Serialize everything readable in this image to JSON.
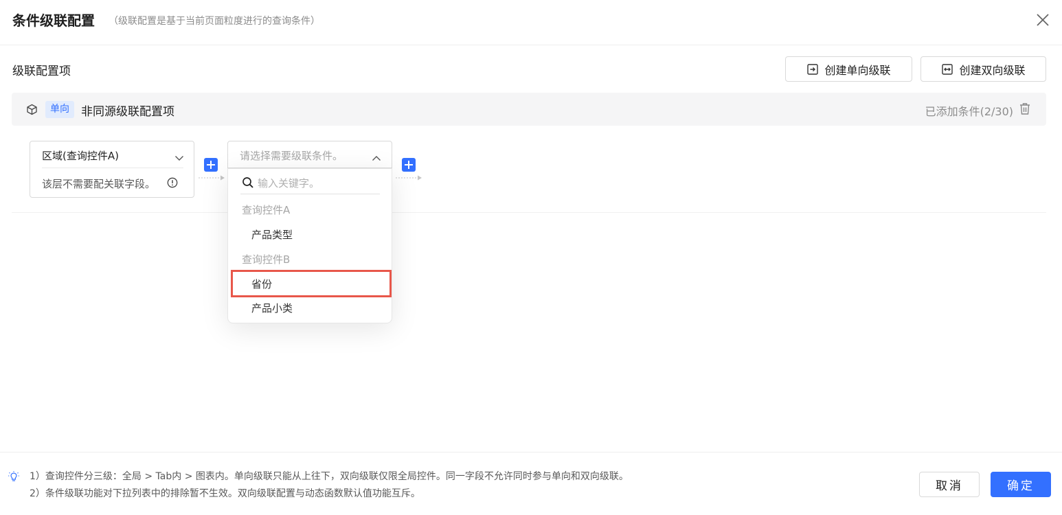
{
  "dialog": {
    "title": "条件级联配置",
    "subtitle": "（级联配置是基于当前页面粒度进行的查询条件）",
    "close_icon": "close-icon"
  },
  "section": {
    "title": "级联配置项",
    "create_one_way": "创建单向级联",
    "create_two_way": "创建双向级联"
  },
  "config_item": {
    "tag": "单向",
    "name": "非同源级联配置项",
    "added_count": "已添加条件(2/30)"
  },
  "node_a": {
    "selected": "区域(查询控件A)",
    "hint": "该层不需要配关联字段。"
  },
  "node_b": {
    "placeholder": "请选择需要级联条件。"
  },
  "dropdown": {
    "search_placeholder": "输入关键字。",
    "groups": [
      {
        "label": "查询控件A",
        "options": [
          "产品类型"
        ]
      },
      {
        "label": "查询控件B",
        "options": [
          "省份",
          "产品小类"
        ]
      }
    ],
    "highlighted_option": "省份"
  },
  "footer": {
    "note_1": "1）查询控件分三级：全局 > Tab内 > 图表内。单向级联只能从上往下，双向级联仅限全局控件。同一字段不允许同时参与单向和双向级联。",
    "note_2": "2）条件级联功能对下拉列表中的排除暂不生效。双向级联配置与动态函数默认值功能互斥。",
    "cancel": "取消",
    "ok": "确定"
  },
  "colors": {
    "primary": "#3370ff",
    "highlight_border": "#e8574a",
    "tag_bg": "#e1ebfd"
  }
}
